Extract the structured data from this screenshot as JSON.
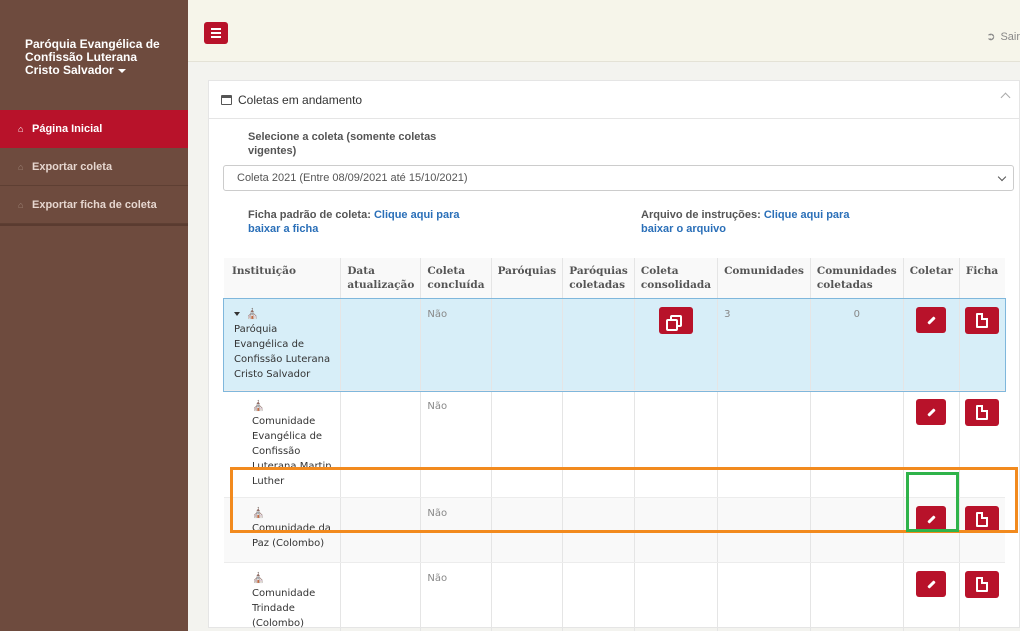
{
  "sidebar": {
    "org_name": "Paróquia Evangélica de Confissão Luterana Cristo Salvador",
    "items": [
      {
        "label": "Página Inicial",
        "icon": "home-icon",
        "active": true
      },
      {
        "label": "Exportar coleta",
        "icon": "home-icon",
        "active": false
      },
      {
        "label": "Exportar ficha de coleta",
        "icon": "home-icon",
        "active": false
      }
    ]
  },
  "topbar": {
    "logout_label": "Sair",
    "menu_icon": "hamburger-icon"
  },
  "panel": {
    "title": "Coletas em andamento",
    "select_label": "Selecione a coleta (somente coletas vigentes)",
    "select_value": "Coleta 2021 (Entre 08/09/2021 até 15/10/2021)",
    "ficha_prefix": "Ficha padrão de coleta:",
    "ficha_link": "Clique aqui para baixar a ficha",
    "arquivo_prefix": "Arquivo de instruções:",
    "arquivo_link": "Clique aqui para baixar o arquivo"
  },
  "table": {
    "headers": [
      "Instituição",
      "Data atualização",
      "Coleta concluída",
      "Paróquias",
      "Paróquias coletadas",
      "Coleta consolidada",
      "Comunidades",
      "Comunidades coletadas",
      "Coletar",
      "Ficha"
    ],
    "rows": [
      {
        "name": "Paróquia Evangélica de Confissão Luterana Cristo Salvador",
        "data": "",
        "concluida": "Não",
        "paroquias": "",
        "paroquias_coletadas": "",
        "comunidades": "3",
        "comunidades_coletadas": "0"
      },
      {
        "name": "Comunidade Evangélica de Confissão Luterana Martin Luther",
        "data": "",
        "concluida": "Não",
        "paroquias": "",
        "paroquias_coletadas": "",
        "comunidades": "",
        "comunidades_coletadas": ""
      },
      {
        "name": "Comunidade da Paz (Colombo)",
        "data": "",
        "concluida": "Não",
        "paroquias": "",
        "paroquias_coletadas": "",
        "comunidades": "",
        "comunidades_coletadas": ""
      },
      {
        "name": "Comunidade Trindade (Colombo)",
        "data": "",
        "concluida": "Não",
        "paroquias": "",
        "paroquias_coletadas": "",
        "comunidades": "",
        "comunidades_coletadas": ""
      }
    ]
  },
  "colors": {
    "accent": "#b8122a",
    "sidebar": "#6e4b3e",
    "link": "#2a6fb8",
    "highlight_row": "#f28a1e",
    "highlight_button": "#2fb34a"
  }
}
